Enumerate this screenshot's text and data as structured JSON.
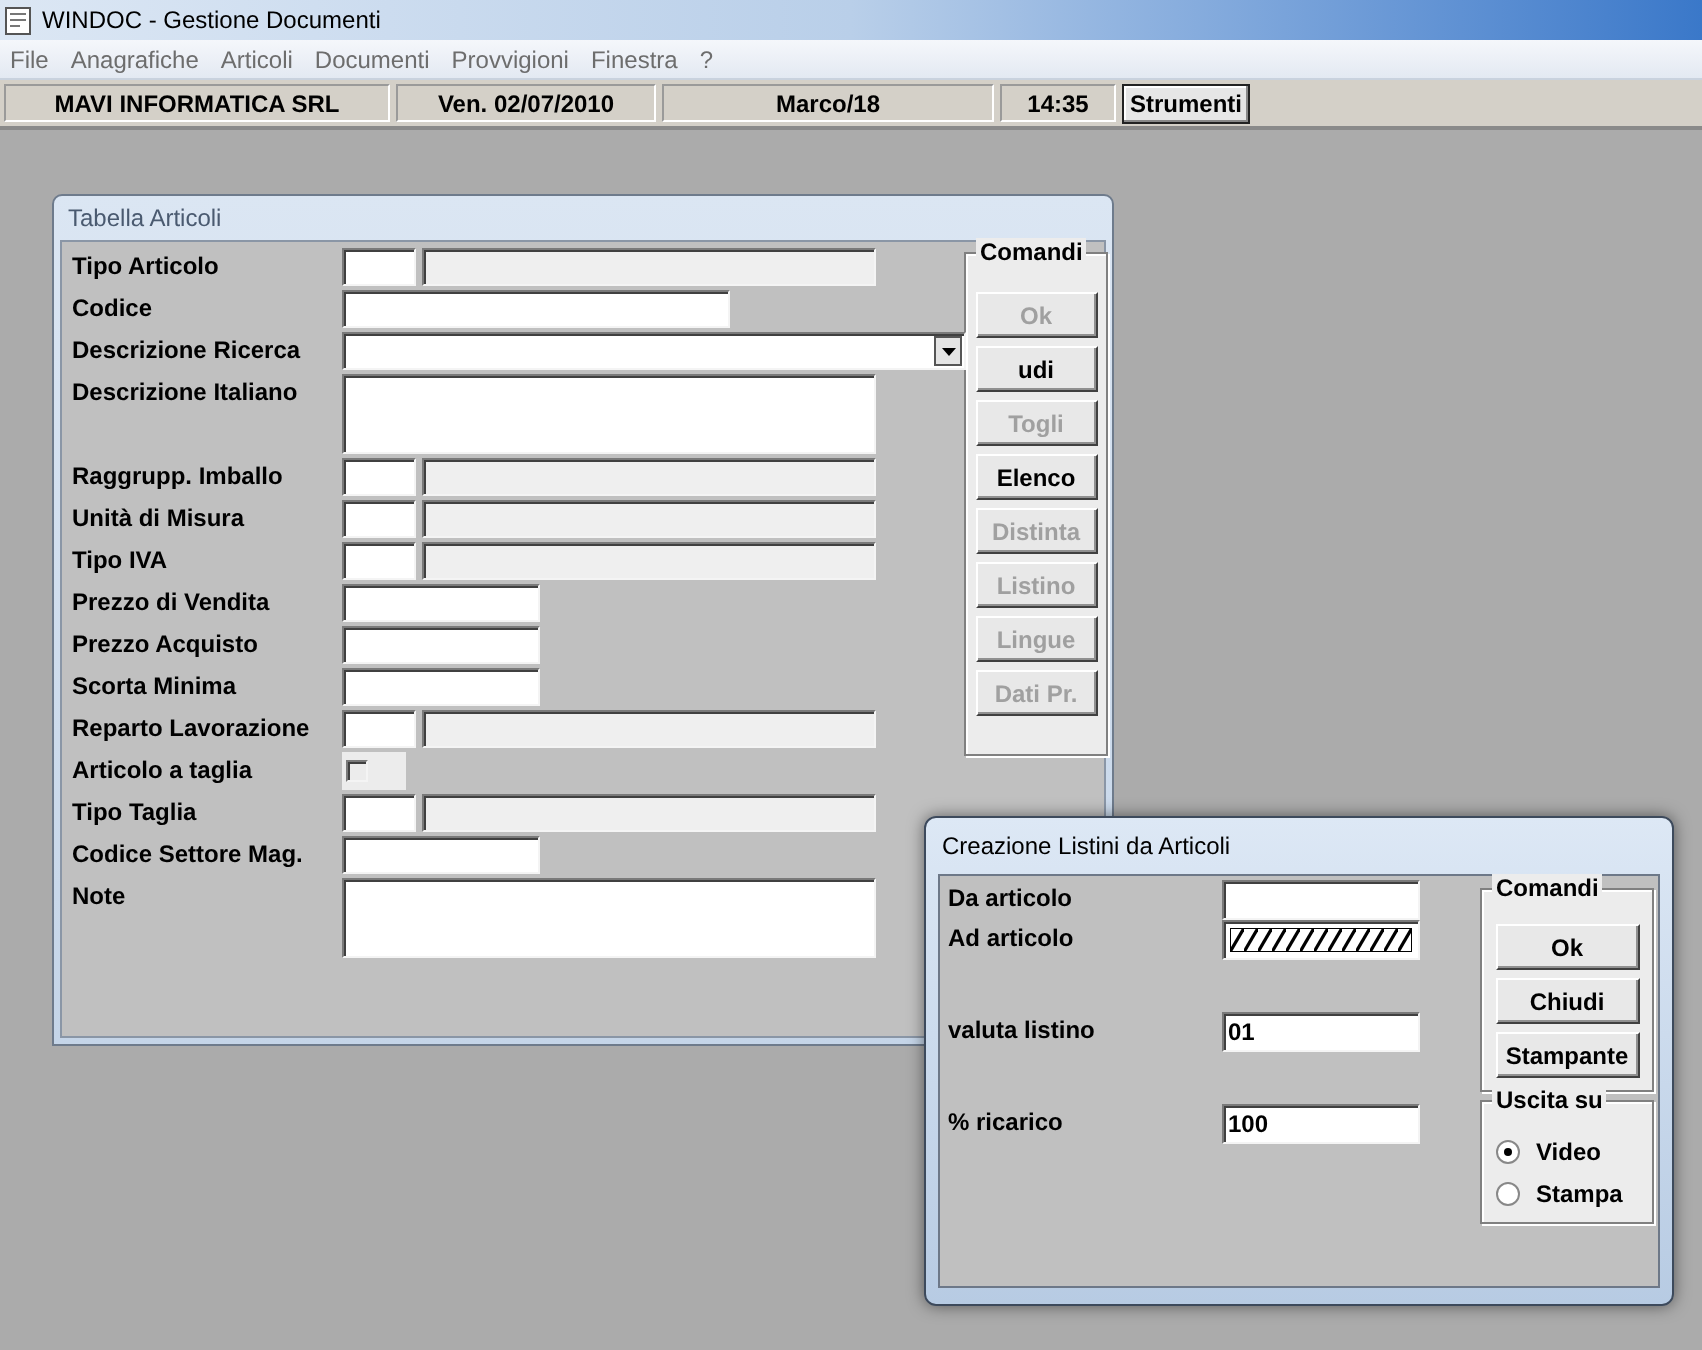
{
  "window": {
    "title": "WINDOC - Gestione Documenti"
  },
  "menu": [
    {
      "label": "File",
      "disabled": true
    },
    {
      "label": "Anagrafiche",
      "disabled": true
    },
    {
      "label": "Articoli",
      "disabled": true
    },
    {
      "label": "Documenti",
      "disabled": true
    },
    {
      "label": "Provvigioni",
      "disabled": true
    },
    {
      "label": "Finestra",
      "disabled": true
    },
    {
      "label": "?",
      "disabled": true
    }
  ],
  "status_bar": {
    "panels": [
      "MAVI INFORMATICA SRL",
      "Ven. 02/07/2010",
      "Marco/18",
      "14:35"
    ],
    "button": "Strumenti"
  },
  "article_window": {
    "title": "Tabella Articoli",
    "fields": [
      {
        "label": "Tipo Articolo",
        "kind": "code_desc"
      },
      {
        "label": "Codice",
        "kind": "text_long"
      },
      {
        "label": "Descrizione Ricerca",
        "kind": "combo"
      },
      {
        "label": "Descrizione Italiano",
        "kind": "memo"
      },
      {
        "label": "Raggrupp. Imballo",
        "kind": "code_desc"
      },
      {
        "label": "Unità di Misura",
        "kind": "code_desc"
      },
      {
        "label": "Tipo IVA",
        "kind": "code_desc"
      },
      {
        "label": "Prezzo di Vendita",
        "kind": "text"
      },
      {
        "label": "Prezzo Acquisto",
        "kind": "text"
      },
      {
        "label": "Scorta Minima",
        "kind": "text"
      },
      {
        "label": "Reparto Lavorazione",
        "kind": "code_desc"
      },
      {
        "label": "Articolo a taglia",
        "kind": "checkbox",
        "checked": false,
        "disabled": true
      },
      {
        "label": "Tipo Taglia",
        "kind": "code_desc"
      },
      {
        "label": "Codice Settore Mag.",
        "kind": "text"
      },
      {
        "label": "Note",
        "kind": "memo"
      }
    ],
    "commands": {
      "title": "Comandi",
      "buttons": [
        {
          "label": "Ok",
          "disabled": true
        },
        {
          "label": "udi",
          "disabled": false
        },
        {
          "label": "Togli",
          "disabled": true
        },
        {
          "label": "Elenco",
          "disabled": false
        },
        {
          "label": "Distinta",
          "disabled": true
        },
        {
          "label": "Listino",
          "disabled": true
        },
        {
          "label": "Lingue",
          "disabled": true
        },
        {
          "label": "Dati Pr.",
          "disabled": true
        }
      ]
    }
  },
  "listini_dialog": {
    "title": "Creazione Listini da Articoli",
    "fields": [
      {
        "label": "Da articolo",
        "kind": "text"
      },
      {
        "label": "Ad articolo",
        "kind": "hatched"
      },
      {
        "label": "valuta listino",
        "kind": "text",
        "value": "01"
      },
      {
        "label": "% ricarico",
        "kind": "text",
        "value": "100"
      }
    ],
    "commands": {
      "title": "Comandi",
      "buttons": [
        {
          "label": "Ok",
          "disabled": false
        },
        {
          "label": "Chiudi",
          "disabled": false
        },
        {
          "label": "Stampante",
          "disabled": false
        }
      ]
    },
    "output": {
      "title": "Uscita su",
      "options": [
        {
          "label": "Video",
          "selected": true
        },
        {
          "label": "Stampa",
          "selected": false
        }
      ]
    }
  }
}
